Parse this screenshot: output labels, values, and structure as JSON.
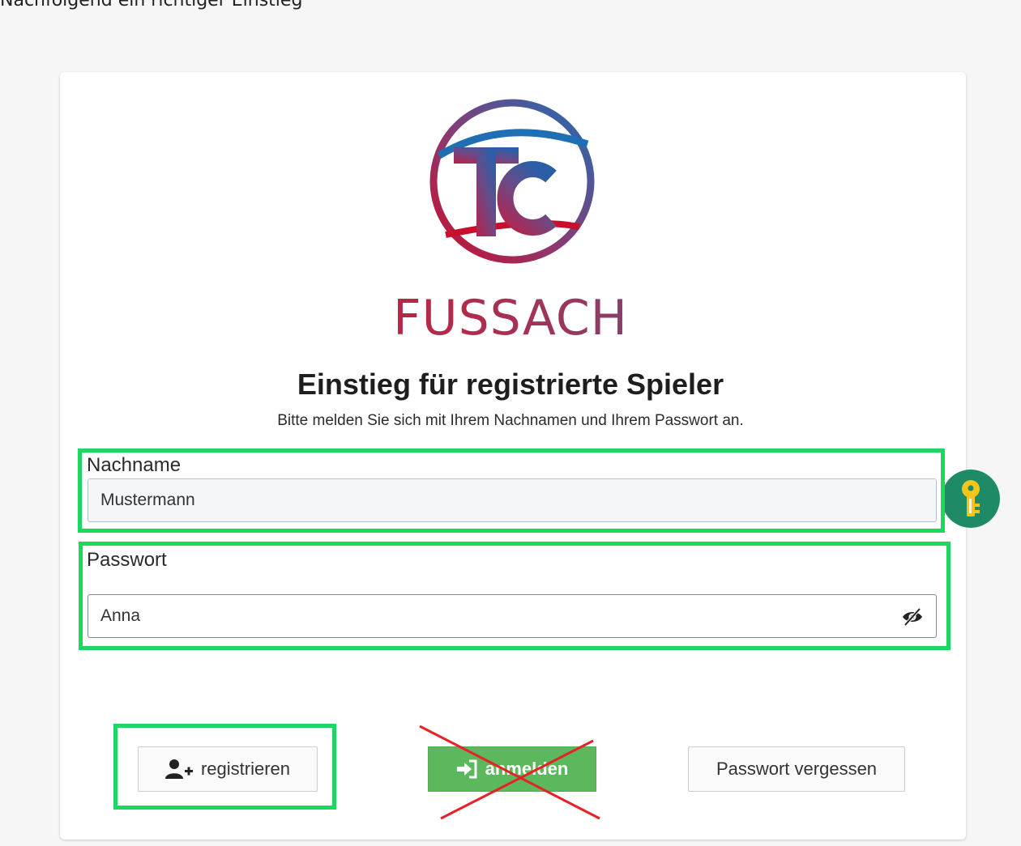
{
  "annotation": {
    "top_text": "Nachfolgend ein richtiger Einstieg"
  },
  "brand": {
    "name": "FUSSACH",
    "monogram": "TC"
  },
  "header": {
    "title": "Einstieg für registrierte Spieler",
    "subtitle": "Bitte melden Sie sich mit Ihrem Nachnamen und Ihrem Passwort an."
  },
  "form": {
    "lastname": {
      "label": "Nachname",
      "value": "Mustermann"
    },
    "password": {
      "label": "Passwort",
      "value": "Anna"
    }
  },
  "buttons": {
    "register": "registrieren",
    "login": "anmelden",
    "forgot": "Passwort vergessen"
  },
  "icons": {
    "register": "user-plus-icon",
    "login": "sign-in-icon",
    "password_toggle": "eye-slash-icon",
    "password_manager": "key-icon"
  },
  "colors": {
    "highlight": "#1ed760",
    "login_button": "#5cb85c",
    "key_badge": "#1f8a66",
    "cross": "#e8202a",
    "logo_red": "#c8102e",
    "logo_blue": "#1f6fb5"
  }
}
